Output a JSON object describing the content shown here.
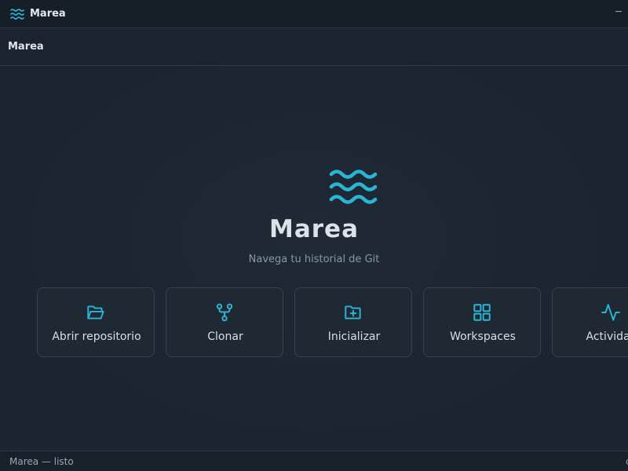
{
  "window": {
    "title": "Marea",
    "minimize_glyph": "─"
  },
  "toolbar": {
    "label": "Marea"
  },
  "hero": {
    "title": "Marea",
    "subtitle": "Navega tu historial de Git"
  },
  "actions": [
    {
      "label": "Abrir repositorio",
      "icon": "folder-open-icon"
    },
    {
      "label": "Clonar",
      "icon": "git-fork-icon"
    },
    {
      "label": "Inicializar",
      "icon": "folder-plus-icon"
    },
    {
      "label": "Workspaces",
      "icon": "grid-icon"
    },
    {
      "label": "Actividad",
      "icon": "activity-icon"
    }
  ],
  "statusbar": {
    "text": "Marea — listo",
    "right_glyph": "c"
  },
  "colors": {
    "accent": "#29b6d6",
    "background": "#1c2531",
    "titlebar": "#161e27",
    "card_border": "#36424f"
  }
}
